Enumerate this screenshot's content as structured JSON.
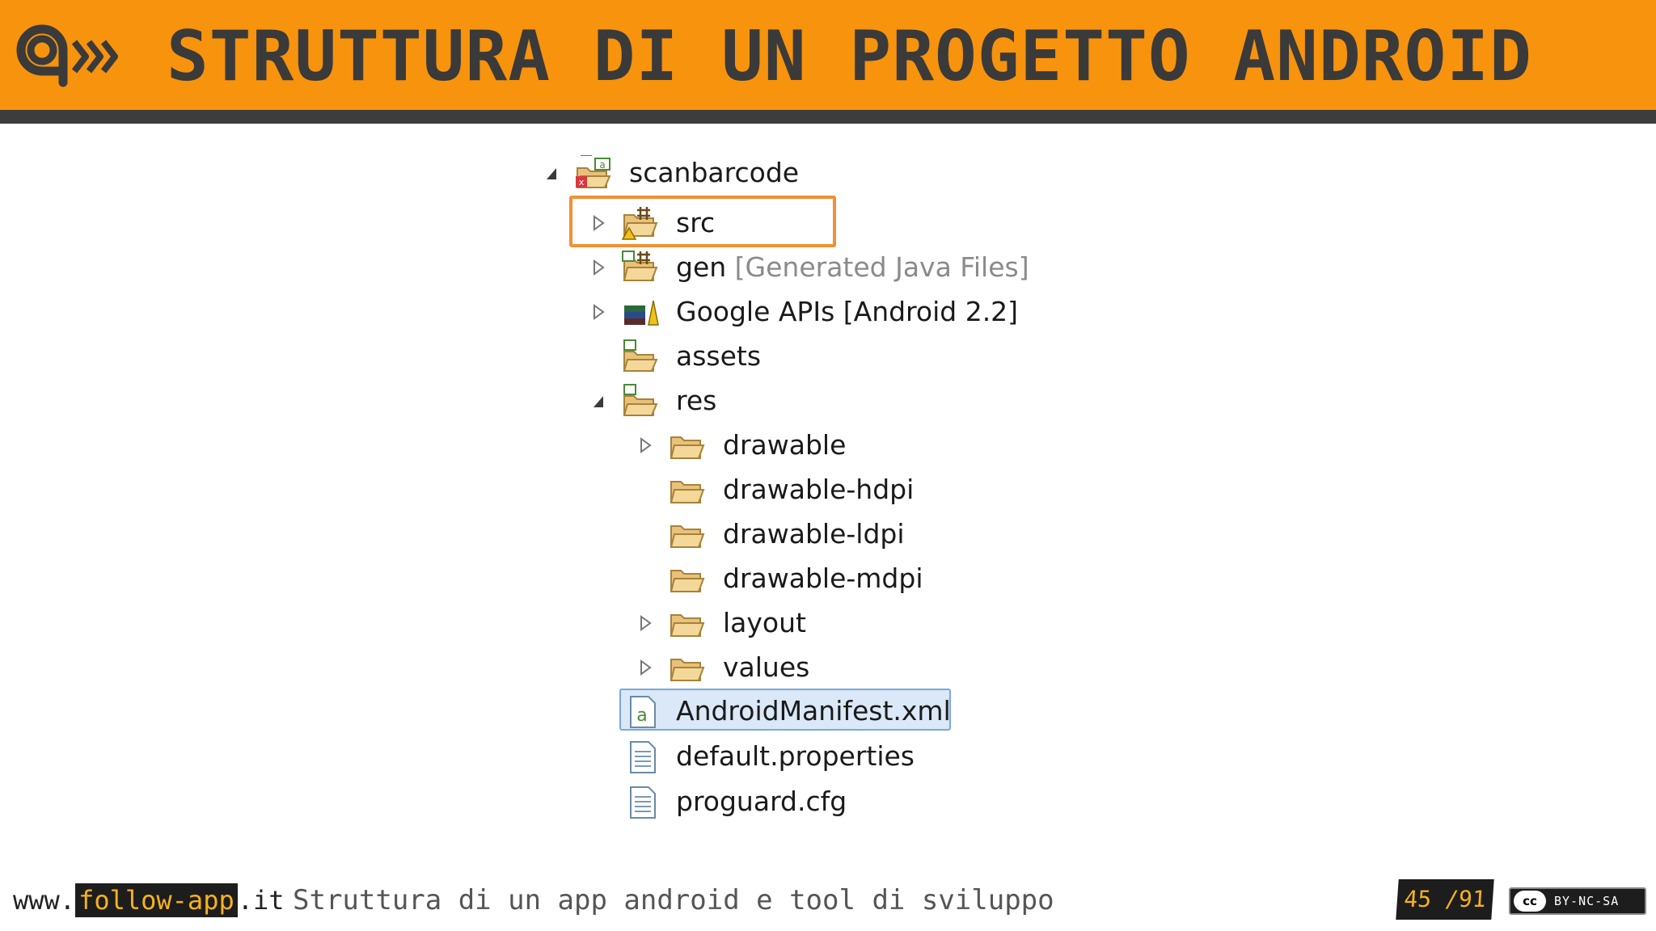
{
  "header": {
    "title": "STRUTTURA DI UN PROGETTO ANDROID",
    "logo_icon": "follow-app-logo-icon",
    "colors": {
      "background": "#f7930d",
      "bar": "#3d3d3d",
      "text": "#3a3a3a"
    }
  },
  "tree": {
    "project": {
      "label": "scanbarcode",
      "icon": "android-project-icon",
      "expanded": true
    },
    "items": [
      {
        "label": "src",
        "icon": "source-package-folder-icon",
        "toggle": "collapsed",
        "highlighted": true
      },
      {
        "label": "gen",
        "extra": "[Generated Java Files]",
        "icon": "generated-package-folder-icon",
        "toggle": "collapsed"
      },
      {
        "label": "Google APIs [Android 2.2]",
        "icon": "library-icon",
        "toggle": "collapsed"
      },
      {
        "label": "assets",
        "icon": "folder-icon"
      },
      {
        "label": "res",
        "icon": "folder-icon",
        "toggle": "expanded",
        "children": [
          {
            "label": "drawable",
            "icon": "folder-icon",
            "toggle": "collapsed"
          },
          {
            "label": "drawable-hdpi",
            "icon": "folder-icon"
          },
          {
            "label": "drawable-ldpi",
            "icon": "folder-icon"
          },
          {
            "label": "drawable-mdpi",
            "icon": "folder-icon"
          },
          {
            "label": "layout",
            "icon": "folder-icon",
            "toggle": "collapsed"
          },
          {
            "label": "values",
            "icon": "folder-icon",
            "toggle": "collapsed"
          }
        ]
      },
      {
        "label": "AndroidManifest.xml",
        "icon": "android-manifest-icon",
        "selected": true
      },
      {
        "label": "default.properties",
        "icon": "text-file-icon"
      },
      {
        "label": "proguard.cfg",
        "icon": "text-file-icon"
      }
    ]
  },
  "footer": {
    "site_prefix": "www.",
    "site_highlight": "follow-app",
    "site_suffix": ".it",
    "subtitle": "Struttura di un app android e tool di sviluppo",
    "page_current": "45",
    "page_total": "/91",
    "license_cc": "cc",
    "license_label": "BY-NC-SA",
    "accent": "#f7b21b"
  }
}
